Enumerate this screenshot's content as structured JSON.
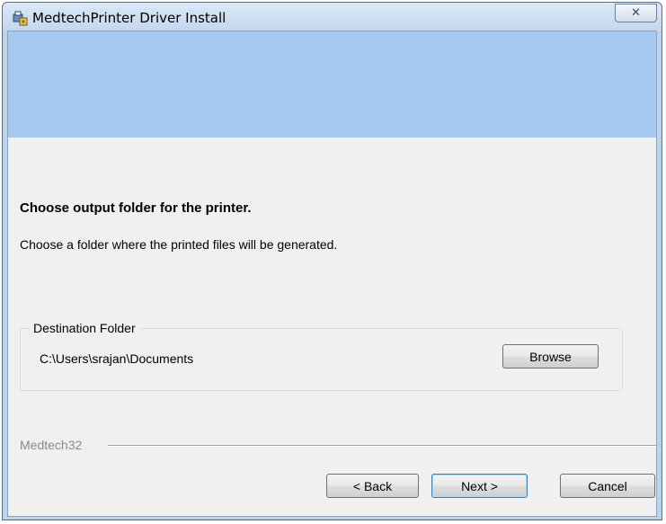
{
  "window": {
    "title": "MedtechPrinter Driver Install",
    "close_label": "✕"
  },
  "content": {
    "heading": "Choose output folder for the printer.",
    "description": "Choose a folder where the printed files will be generated."
  },
  "destination": {
    "legend": "Destination Folder",
    "path": "C:\\Users\\srajan\\Documents",
    "browse_label": "Browse"
  },
  "footer": {
    "brand": "Medtech32",
    "back_label": "< Back",
    "next_label": "Next >",
    "cancel_label": "Cancel"
  },
  "icons": {
    "app": "printer-installer-icon",
    "close": "close-icon"
  },
  "colors": {
    "banner": "#a6c9f0",
    "dialog_background": "#f0f0f0",
    "titlebar": "#c4d7ee"
  }
}
